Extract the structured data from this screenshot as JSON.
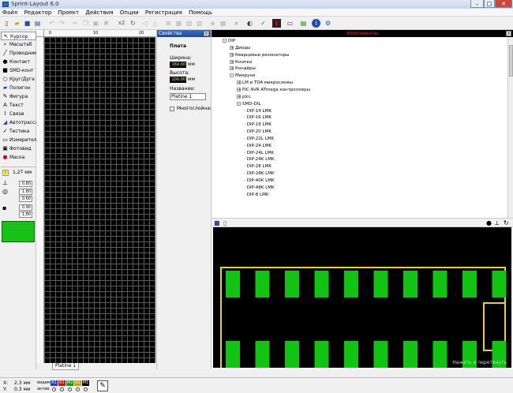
{
  "window": {
    "title": "Sprint-Layout 6.0"
  },
  "menu": [
    "Файл",
    "Редактор",
    "Проект",
    "Действия",
    "Опции",
    "Регистрация",
    "Помощь"
  ],
  "toolbar": {
    "zoom_label": "x2"
  },
  "tools": [
    {
      "label": "Курсор",
      "icon": "cursor-icon",
      "selected": true
    },
    {
      "label": "Масштаб",
      "icon": "zoom-icon"
    },
    {
      "label": "Проводник",
      "icon": "track-icon"
    },
    {
      "label": "Контакт",
      "icon": "pad-icon"
    },
    {
      "label": "SMD-конт",
      "icon": "smd-pad-icon"
    },
    {
      "label": "Круг/Дуга",
      "icon": "circle-icon"
    },
    {
      "label": "Полигон",
      "icon": "polygon-icon"
    },
    {
      "label": "Фигура",
      "icon": "shape-icon"
    },
    {
      "label": "Текст",
      "icon": "text-icon"
    },
    {
      "label": "Связи",
      "icon": "connection-icon"
    },
    {
      "label": "Автотрасса",
      "icon": "autoroute-icon"
    },
    {
      "label": "Тестика",
      "icon": "test-icon"
    },
    {
      "label": "Измеритель",
      "icon": "ruler-icon"
    },
    {
      "label": "Фотовид",
      "icon": "photoview-icon"
    },
    {
      "label": "Маска",
      "icon": "mask-icon"
    }
  ],
  "grid": {
    "value": "1,27 мм"
  },
  "params": [
    "0.80",
    "1.80",
    "0.60",
    "0.90",
    "1.80"
  ],
  "ruler": {
    "marks": [
      "0",
      "10",
      "20"
    ]
  },
  "tab": {
    "label": "Platine 1"
  },
  "properties": {
    "title": "Свойства",
    "section": "Плата",
    "width_label": "Ширина:",
    "width_value": "160.00",
    "height_label": "Высота:",
    "height_value": "100.00",
    "unit": "мм",
    "name_label": "Название:",
    "name_value": "Platine 1",
    "multilayer_label": "Многослойная"
  },
  "components": {
    "title": "Компоненты",
    "tree": [
      {
        "label": "DIP",
        "level": 0,
        "exp": "-"
      },
      {
        "label": "Диоды",
        "level": 1,
        "exp": "+"
      },
      {
        "label": "Кварцевые резонаторы",
        "level": 1,
        "exp": "+"
      },
      {
        "label": "Кнопки",
        "level": 1,
        "exp": "+"
      },
      {
        "label": "Кондёры",
        "level": 1,
        "exp": "+"
      },
      {
        "label": "Микрухи",
        "level": 1,
        "exp": "-"
      },
      {
        "label": "LM и TDA микросхемы",
        "level": 2,
        "exp": "+"
      },
      {
        "label": "PIC AVR ATmega контроллеры",
        "level": 2,
        "exp": "+"
      },
      {
        "label": "plcc",
        "level": 2,
        "exp": "+"
      },
      {
        "label": "SMD-DIL",
        "level": 2,
        "exp": "-"
      },
      {
        "label": "DIP-14 LMK",
        "level": 3
      },
      {
        "label": "DIP-16 LMK",
        "level": 3
      },
      {
        "label": "DIP-18 LMK",
        "level": 3
      },
      {
        "label": "DIP-20 LMK",
        "level": 3
      },
      {
        "label": "DIP-22L LMK",
        "level": 3
      },
      {
        "label": "DIP-24 LMK",
        "level": 3
      },
      {
        "label": "DIP-24L LMK",
        "level": 3
      },
      {
        "label": "DIP-24K LMK",
        "level": 3
      },
      {
        "label": "DIP-28 LMK",
        "level": 3
      },
      {
        "label": "DIP-28K LMK",
        "level": 3
      },
      {
        "label": "DIP-40K LMK",
        "level": 3
      },
      {
        "label": "DIP-48K LMK",
        "level": 3
      },
      {
        "label": "DIP-8 LMK",
        "level": 3
      }
    ],
    "preview_hint": "Нажать и перетянуть"
  },
  "status": {
    "x_label": "X:",
    "x_value": "2,3 мм",
    "y_label": "Y:",
    "y_value": "0,3 мм",
    "visible_label": "видим.",
    "active_label": "актив.",
    "layers": [
      {
        "name": "K1",
        "color": "#1f3fd0"
      },
      {
        "name": "K1",
        "color": "#d01010"
      },
      {
        "name": "M2",
        "color": "#0f9a0f"
      },
      {
        "name": "K2",
        "color": "#c8a000"
      },
      {
        "name": "M1",
        "color": "#000000"
      }
    ]
  },
  "colors": {
    "pad": "#13c313",
    "outline": "#e8d800",
    "canvas": "#000000",
    "header_red": "#ff2020"
  }
}
